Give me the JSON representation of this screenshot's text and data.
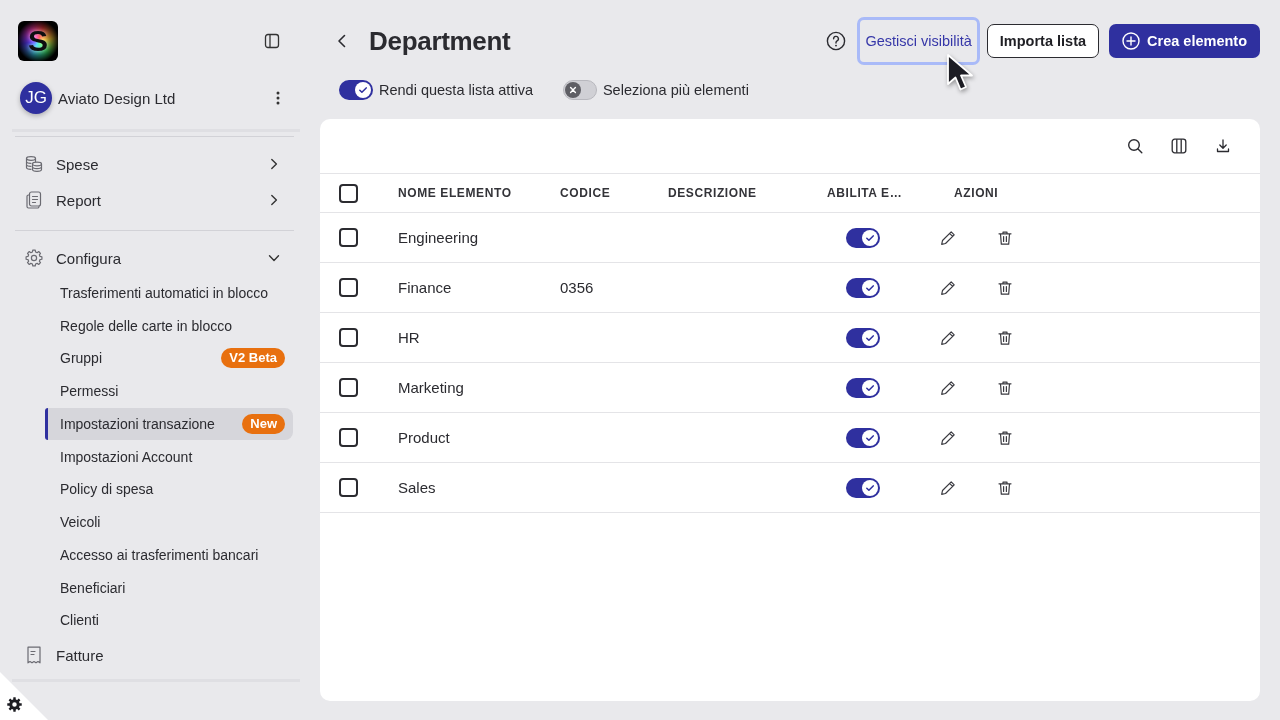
{
  "sidebar": {
    "logo": "S",
    "account": {
      "initials": "JG",
      "name": "Aviato Design Ltd"
    },
    "nav_sections": [
      {
        "items": [
          {
            "label": "Spese",
            "expanded": false
          },
          {
            "label": "Report",
            "expanded": false
          }
        ]
      },
      {
        "items": [
          {
            "label": "Configura",
            "expanded": true,
            "children": [
              {
                "label": "Trasferimenti automatici in blocco",
                "selected": false
              },
              {
                "label": "Regole delle carte in blocco",
                "selected": false
              },
              {
                "label": "Gruppi",
                "selected": false,
                "badge": "V2 Beta"
              },
              {
                "label": "Permessi",
                "selected": false
              },
              {
                "label": "Impostazioni transazione",
                "selected": true,
                "badge": "New"
              },
              {
                "label": "Impostazioni Account",
                "selected": false
              },
              {
                "label": "Policy di spesa",
                "selected": false
              },
              {
                "label": "Veicoli",
                "selected": false
              },
              {
                "label": "Accesso ai trasferimenti bancari",
                "selected": false
              },
              {
                "label": "Beneficiari",
                "selected": false
              },
              {
                "label": "Clienti",
                "selected": false
              }
            ]
          },
          {
            "label": "Fatture"
          }
        ]
      }
    ]
  },
  "header": {
    "title": "Department",
    "buttons": [
      {
        "label": "Gestisci visibilità",
        "kind": "link",
        "focused": true
      },
      {
        "label": "Importa lista",
        "kind": "secondary"
      },
      {
        "label": "Crea elemento",
        "kind": "primary"
      }
    ]
  },
  "switches": [
    {
      "label": "Rendi questa lista attiva",
      "on": true
    },
    {
      "label": "Seleziona più elementi",
      "on": false
    }
  ],
  "table": {
    "select_all_checked": false,
    "columns": [
      "NOME ELEMENTO",
      "CODICE",
      "DESCRIZIONE",
      "ABILITA E…",
      "AZIONI"
    ],
    "rows": [
      {
        "checked": false,
        "name": "Engineering",
        "enabled": true
      },
      {
        "checked": false,
        "name": "Finance",
        "code": "0356",
        "enabled": true
      },
      {
        "checked": false,
        "name": "HR",
        "enabled": true
      },
      {
        "checked": false,
        "name": "Marketing",
        "enabled": true
      },
      {
        "checked": false,
        "name": "Product",
        "enabled": true
      },
      {
        "checked": false,
        "name": "Sales",
        "enabled": true
      }
    ]
  }
}
